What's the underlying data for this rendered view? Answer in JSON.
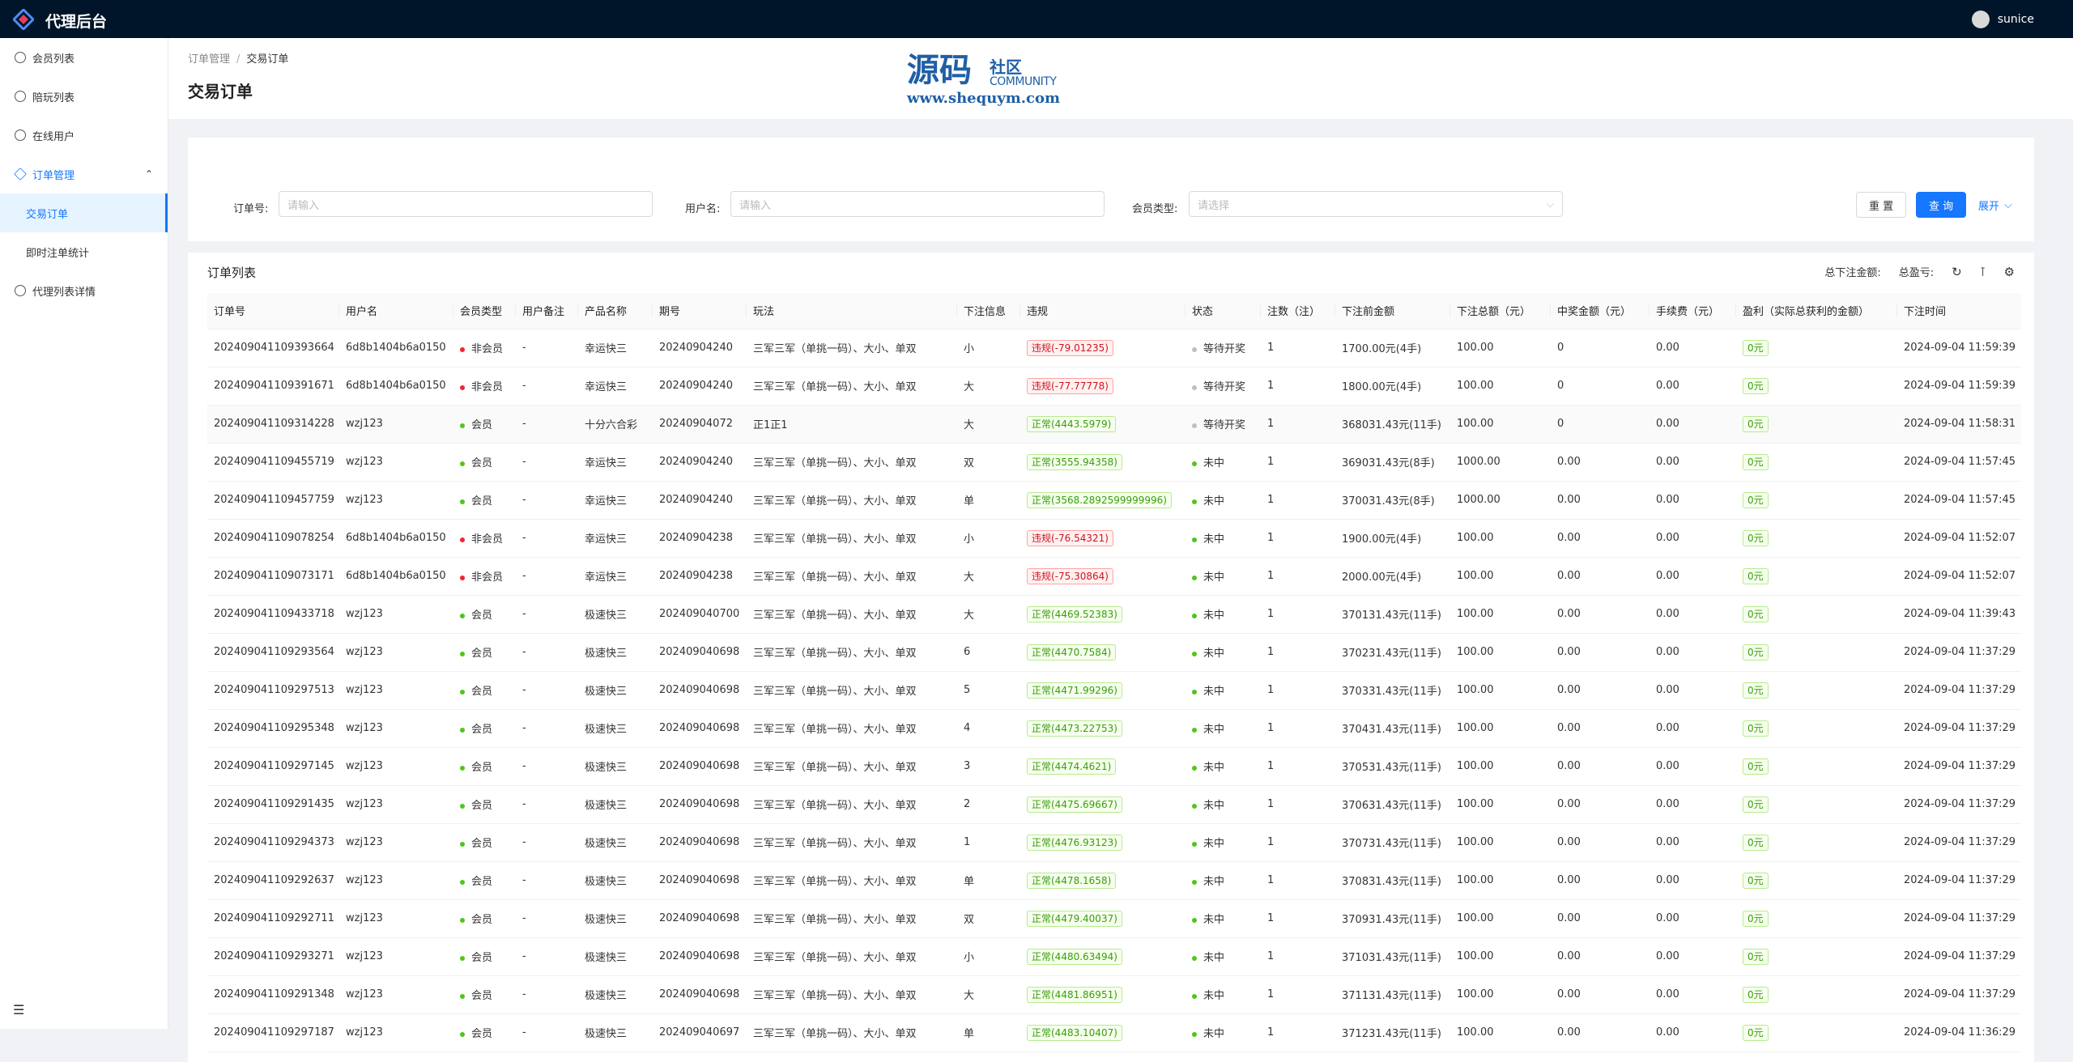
{
  "app": {
    "title": "代理后台",
    "username": "sunice"
  },
  "sidebar": {
    "items": [
      {
        "label": "会员列表",
        "type": "top"
      },
      {
        "label": "陪玩列表",
        "type": "top"
      },
      {
        "label": "在线用户",
        "type": "top"
      },
      {
        "label": "订单管理",
        "type": "open"
      },
      {
        "label": "交易订单",
        "type": "active"
      },
      {
        "label": "即时注单统计",
        "type": "sub"
      },
      {
        "label": "代理列表详情",
        "type": "top"
      }
    ]
  },
  "breadcrumb": {
    "parent": "订单管理",
    "current": "交易订单"
  },
  "page": {
    "title": "交易订单"
  },
  "watermark": {
    "big": "源码",
    "small1": "社区",
    "small2": "COMMUNITY",
    "url": "www.shequym.com"
  },
  "search": {
    "order_label": "订单号:",
    "order_placeholder": "请输入",
    "user_label": "用户名:",
    "user_placeholder": "请输入",
    "type_label": "会员类型:",
    "type_placeholder": "请选择",
    "reset": "重 置",
    "query": "查 询",
    "expand": "展开"
  },
  "table": {
    "title": "订单列表",
    "total_bet_label": "总下注金额:",
    "total_profit_label": "总盈亏:",
    "columns": [
      "订单号",
      "用户名",
      "会员类型",
      "用户备注",
      "产品名称",
      "期号",
      "玩法",
      "下注信息",
      "违规",
      "状态",
      "注数（注）",
      "下注前金额",
      "下注总额（元）",
      "中奖金额（元）",
      "手续费（元）",
      "盈利（实际总获利的金额）",
      "下注时间"
    ],
    "rows": [
      [
        "202409041109393664",
        "6d8b1404b6a0150",
        "非会员",
        "-",
        "幸运快三",
        "20240904240",
        "三军三军（单挑一码）、大小、单双",
        "小",
        "违规(-79.01235)",
        "等待开奖",
        "1",
        "1700.00元(4手)",
        "100.00",
        "0",
        "0.00",
        "0元",
        "2024-09-04 11:59:39"
      ],
      [
        "202409041109391671",
        "6d8b1404b6a0150",
        "非会员",
        "-",
        "幸运快三",
        "20240904240",
        "三军三军（单挑一码）、大小、单双",
        "大",
        "违规(-77.77778)",
        "等待开奖",
        "1",
        "1800.00元(4手)",
        "100.00",
        "0",
        "0.00",
        "0元",
        "2024-09-04 11:59:39"
      ],
      [
        "202409041109314228",
        "wzj123",
        "会员",
        "-",
        "十分六合彩",
        "20240904072",
        "正1正1",
        "大",
        "正常(4443.5979)",
        "等待开奖",
        "1",
        "368031.43元(11手)",
        "100.00",
        "0",
        "0.00",
        "0元",
        "2024-09-04 11:58:31"
      ],
      [
        "202409041109455719",
        "wzj123",
        "会员",
        "-",
        "幸运快三",
        "20240904240",
        "三军三军（单挑一码）、大小、单双",
        "双",
        "正常(3555.94358)",
        "未中",
        "1",
        "369031.43元(8手)",
        "1000.00",
        "0.00",
        "0.00",
        "0元",
        "2024-09-04 11:57:45"
      ],
      [
        "202409041109457759",
        "wzj123",
        "会员",
        "-",
        "幸运快三",
        "20240904240",
        "三军三军（单挑一码）、大小、单双",
        "单",
        "正常(3568.2892599999996)",
        "未中",
        "1",
        "370031.43元(8手)",
        "1000.00",
        "0.00",
        "0.00",
        "0元",
        "2024-09-04 11:57:45"
      ],
      [
        "202409041109078254",
        "6d8b1404b6a0150",
        "非会员",
        "-",
        "幸运快三",
        "20240904238",
        "三军三军（单挑一码）、大小、单双",
        "小",
        "违规(-76.54321)",
        "未中",
        "1",
        "1900.00元(4手)",
        "100.00",
        "0.00",
        "0.00",
        "0元",
        "2024-09-04 11:52:07"
      ],
      [
        "202409041109073171",
        "6d8b1404b6a0150",
        "非会员",
        "-",
        "幸运快三",
        "20240904238",
        "三军三军（单挑一码）、大小、单双",
        "大",
        "违规(-75.30864)",
        "未中",
        "1",
        "2000.00元(4手)",
        "100.00",
        "0.00",
        "0.00",
        "0元",
        "2024-09-04 11:52:07"
      ],
      [
        "202409041109433718",
        "wzj123",
        "会员",
        "-",
        "极速快三",
        "202409040700",
        "三军三军（单挑一码）、大小、单双",
        "大",
        "正常(4469.52383)",
        "未中",
        "1",
        "370131.43元(11手)",
        "100.00",
        "0.00",
        "0.00",
        "0元",
        "2024-09-04 11:39:43"
      ],
      [
        "202409041109293564",
        "wzj123",
        "会员",
        "-",
        "极速快三",
        "202409040698",
        "三军三军（单挑一码）、大小、单双",
        "6",
        "正常(4470.7584)",
        "未中",
        "1",
        "370231.43元(11手)",
        "100.00",
        "0.00",
        "0.00",
        "0元",
        "2024-09-04 11:37:29"
      ],
      [
        "202409041109297513",
        "wzj123",
        "会员",
        "-",
        "极速快三",
        "202409040698",
        "三军三军（单挑一码）、大小、单双",
        "5",
        "正常(4471.99296)",
        "未中",
        "1",
        "370331.43元(11手)",
        "100.00",
        "0.00",
        "0.00",
        "0元",
        "2024-09-04 11:37:29"
      ],
      [
        "202409041109295348",
        "wzj123",
        "会员",
        "-",
        "极速快三",
        "202409040698",
        "三军三军（单挑一码）、大小、单双",
        "4",
        "正常(4473.22753)",
        "未中",
        "1",
        "370431.43元(11手)",
        "100.00",
        "0.00",
        "0.00",
        "0元",
        "2024-09-04 11:37:29"
      ],
      [
        "202409041109297145",
        "wzj123",
        "会员",
        "-",
        "极速快三",
        "202409040698",
        "三军三军（单挑一码）、大小、单双",
        "3",
        "正常(4474.4621)",
        "未中",
        "1",
        "370531.43元(11手)",
        "100.00",
        "0.00",
        "0.00",
        "0元",
        "2024-09-04 11:37:29"
      ],
      [
        "202409041109291435",
        "wzj123",
        "会员",
        "-",
        "极速快三",
        "202409040698",
        "三军三军（单挑一码）、大小、单双",
        "2",
        "正常(4475.69667)",
        "未中",
        "1",
        "370631.43元(11手)",
        "100.00",
        "0.00",
        "0.00",
        "0元",
        "2024-09-04 11:37:29"
      ],
      [
        "202409041109294373",
        "wzj123",
        "会员",
        "-",
        "极速快三",
        "202409040698",
        "三军三军（单挑一码）、大小、单双",
        "1",
        "正常(4476.93123)",
        "未中",
        "1",
        "370731.43元(11手)",
        "100.00",
        "0.00",
        "0.00",
        "0元",
        "2024-09-04 11:37:29"
      ],
      [
        "202409041109292637",
        "wzj123",
        "会员",
        "-",
        "极速快三",
        "202409040698",
        "三军三军（单挑一码）、大小、单双",
        "单",
        "正常(4478.1658)",
        "未中",
        "1",
        "370831.43元(11手)",
        "100.00",
        "0.00",
        "0.00",
        "0元",
        "2024-09-04 11:37:29"
      ],
      [
        "202409041109292711",
        "wzj123",
        "会员",
        "-",
        "极速快三",
        "202409040698",
        "三军三军（单挑一码）、大小、单双",
        "双",
        "正常(4479.40037)",
        "未中",
        "1",
        "370931.43元(11手)",
        "100.00",
        "0.00",
        "0.00",
        "0元",
        "2024-09-04 11:37:29"
      ],
      [
        "202409041109293271",
        "wzj123",
        "会员",
        "-",
        "极速快三",
        "202409040698",
        "三军三军（单挑一码）、大小、单双",
        "小",
        "正常(4480.63494)",
        "未中",
        "1",
        "371031.43元(11手)",
        "100.00",
        "0.00",
        "0.00",
        "0元",
        "2024-09-04 11:37:29"
      ],
      [
        "202409041109291348",
        "wzj123",
        "会员",
        "-",
        "极速快三",
        "202409040698",
        "三军三军（单挑一码）、大小、单双",
        "大",
        "正常(4481.86951)",
        "未中",
        "1",
        "371131.43元(11手)",
        "100.00",
        "0.00",
        "0.00",
        "0元",
        "2024-09-04 11:37:29"
      ],
      [
        "202409041109297187",
        "wzj123",
        "会员",
        "-",
        "极速快三",
        "202409040697",
        "三军三军（单挑一码）、大小、单双",
        "单",
        "正常(4483.10407)",
        "未中",
        "1",
        "371231.43元(11手)",
        "100.00",
        "0.00",
        "0.00",
        "0元",
        "2024-09-04 11:36:29"
      ]
    ]
  },
  "colors": {
    "accent": "#1677ff",
    "header_bg": "#001529",
    "non_member": "#f5222d",
    "member": "#52c41a",
    "pending": "#bfbfbf",
    "lost": "#52c41a"
  }
}
